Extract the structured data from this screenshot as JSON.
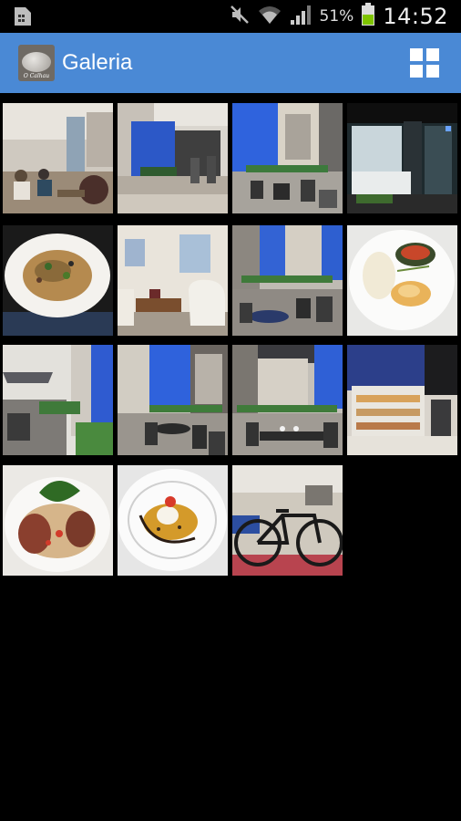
{
  "status_bar": {
    "left_icon": "sim-card-icon",
    "icons": [
      "mute-icon",
      "wifi-icon",
      "signal-icon"
    ],
    "battery_percent": "51%",
    "battery_level": 0.51,
    "time": "14:52"
  },
  "action_bar": {
    "logo_text": "O Calhau",
    "title": "Galeria",
    "view_toggle_icon": "grid-view-icon",
    "color": "#4a89d5"
  },
  "gallery": {
    "photos": [
      {
        "subject": "cafe-interior-photo"
      },
      {
        "subject": "blue-facade-terrace-photo"
      },
      {
        "subject": "entrance-terrace-photo"
      },
      {
        "subject": "display-counter-photo"
      },
      {
        "subject": "pasta-plate-photo"
      },
      {
        "subject": "lounge-corner-photo"
      },
      {
        "subject": "courtyard-tables-photo"
      },
      {
        "subject": "fish-dish-photo"
      },
      {
        "subject": "alley-terrace-photo"
      },
      {
        "subject": "blue-wall-terrace-photo"
      },
      {
        "subject": "terrace-dining-photo"
      },
      {
        "subject": "pastry-counter-photo"
      },
      {
        "subject": "salad-plate-photo"
      },
      {
        "subject": "dessert-plate-photo"
      },
      {
        "subject": "bicycle-photo"
      }
    ]
  }
}
